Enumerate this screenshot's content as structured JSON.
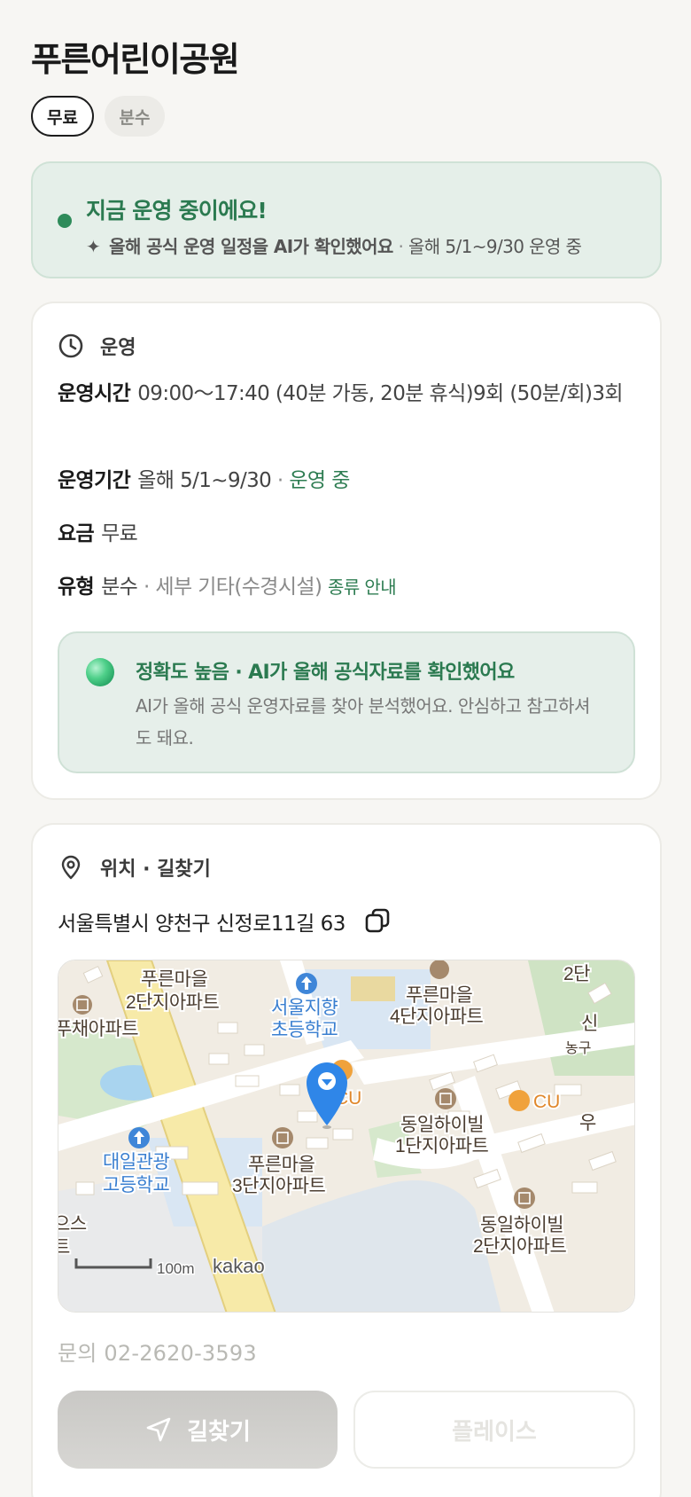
{
  "page": {
    "title": "푸른어린이공원",
    "chips": [
      "무료",
      "분수"
    ]
  },
  "status": {
    "title": "지금 운영 중이에요!",
    "sparkle": "✦",
    "ai_note": "올해 공식 운영 일정을 AI가 확인했어요",
    "separator": " · ",
    "period": "올해 5/1~9/30 운영 중"
  },
  "operation": {
    "section_title": "운영",
    "hours_label": "운영시간",
    "hours_value": "09:00～17:40 (40분 가동, 20분 휴식)9회 (50분/회)3회",
    "period_label": "운영기간",
    "period_value": "올해 5/1~9/30",
    "period_sep": " · ",
    "period_status": "운영 중",
    "fee_label": "요금",
    "fee_value": "무료",
    "type_label": "유형",
    "type_value": "분수",
    "type_detail": " · 세부 기타(수경시설)",
    "type_link": "종류 안내",
    "accuracy": {
      "title": "정확도 높음 · AI가 올해 공식자료를 확인했어요",
      "body": "AI가 올해 공식 운영자료를 찾아 분석했어요. 안심하고 참고하셔도 돼요."
    }
  },
  "location": {
    "section_title": "위치 · 길찾기",
    "address": "서울특별시 양천구 신정로11길 63",
    "map_labels": {
      "apt2_a": "푸른마을",
      "apt2_b": "2단지아파트",
      "school_a": "서울지향",
      "school_b": "초등학교",
      "apt4_a": "푸른마을",
      "apt4_b": "4단지아파트",
      "chae": "푸채아파트",
      "edge_top": "2단",
      "edge_r1": "신",
      "edge_r2": "농구",
      "cu1": "CU",
      "cu2": "CU",
      "dongil1_a": "동일하이빌",
      "dongil1_b": "1단지아파트",
      "daeil_a": "대일관광",
      "daeil_b": "고등학교",
      "apt3_a": "푸른마을",
      "apt3_b": "3단지아파트",
      "dongil2_a": "동일하이빌",
      "dongil2_b": "2단지아파트",
      "edge_l1": "으스",
      "edge_l2": "트",
      "edge_r3": "우",
      "scale": "100m",
      "brand": "kakao"
    },
    "contact": "문의 02-2620-3593"
  },
  "actions": {
    "route": "길찾기",
    "place": "플레이스"
  },
  "colors": {
    "accent_green": "#2e8b5a",
    "status_bg": "#e5efe9",
    "marker_blue": "#2f86e8"
  }
}
